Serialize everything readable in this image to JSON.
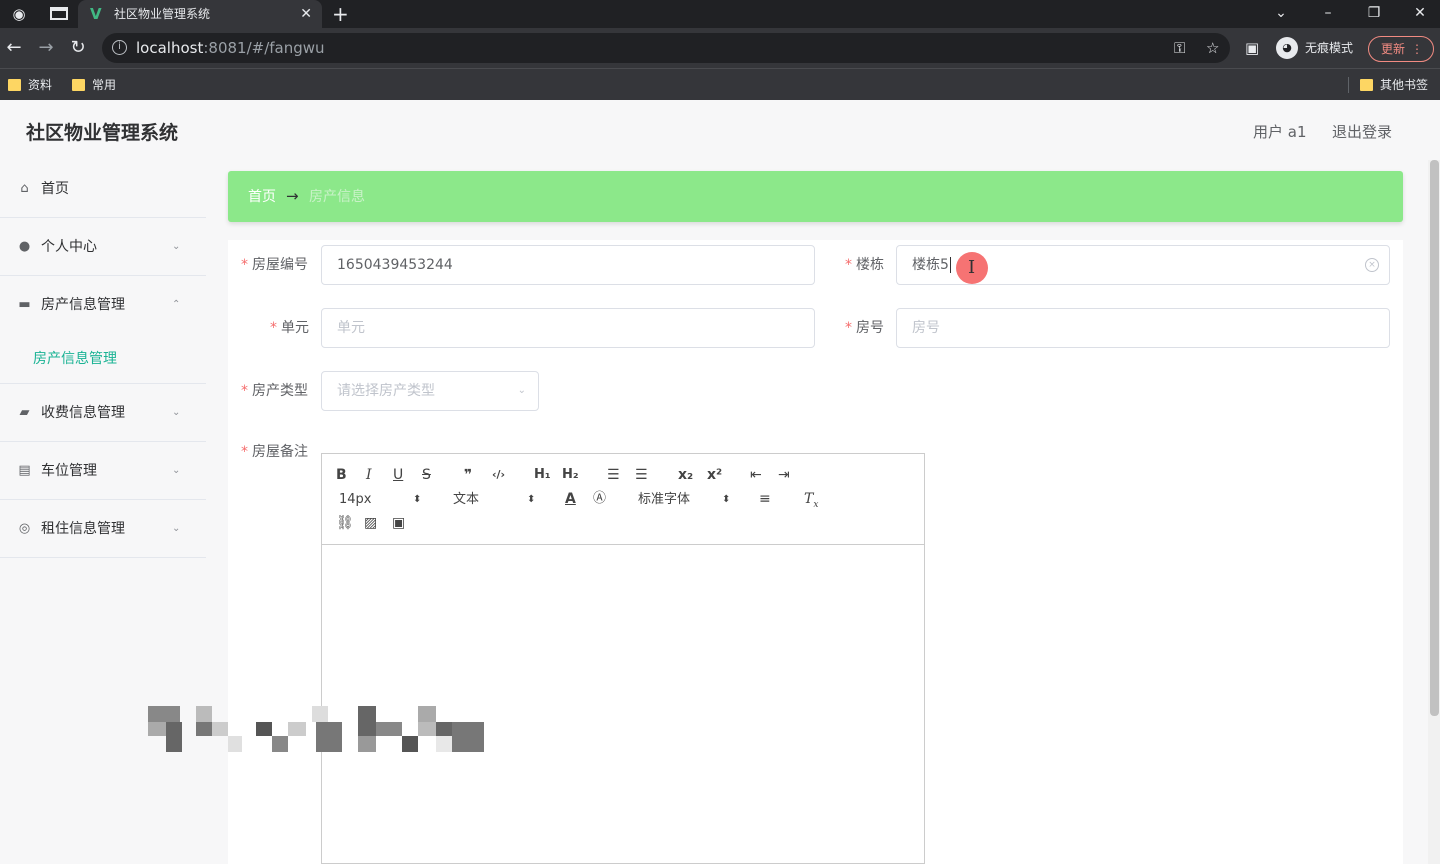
{
  "browser": {
    "tab_title": "社区物业管理系统",
    "tab_close": "✕",
    "new_tab": "+",
    "url_host": "localhost",
    "url_rest": ":8081/#/fangwu",
    "incognito_label": "无痕模式",
    "update_label": "更新",
    "bookmarks": [
      "资料",
      "常用"
    ],
    "other_bookmarks": "其他书签"
  },
  "app": {
    "title": "社区物业管理系统",
    "user": "用户 a1",
    "logout": "退出登录"
  },
  "sidebar": {
    "items": [
      {
        "label": "首页",
        "icon": "home-icon"
      },
      {
        "label": "个人中心",
        "icon": "user-icon"
      },
      {
        "label": "房产信息管理",
        "icon": "monitor-icon"
      },
      {
        "label": "收费信息管理",
        "icon": "briefcase-icon"
      },
      {
        "label": "车位管理",
        "icon": "clipboard-icon"
      },
      {
        "label": "租住信息管理",
        "icon": "circle-icon"
      }
    ],
    "active_sub": "房产信息管理"
  },
  "breadcrumb": {
    "home": "首页",
    "current": "房产信息"
  },
  "form": {
    "house_no_label": "房屋编号",
    "house_no_value": "1650439453244",
    "building_label": "楼栋",
    "building_value": "楼栋5",
    "unit_label": "单元",
    "unit_placeholder": "单元",
    "room_label": "房号",
    "room_placeholder": "房号",
    "type_label": "房产类型",
    "type_placeholder": "请选择房产类型",
    "notes_label": "房屋备注"
  },
  "editor": {
    "font_size": "14px",
    "header_select": "文本",
    "font_family": "标准字体"
  },
  "colors": {
    "breadcrumb_bg": "#8ce88a",
    "accent": "#1ab394",
    "required": "#f56c6c"
  }
}
